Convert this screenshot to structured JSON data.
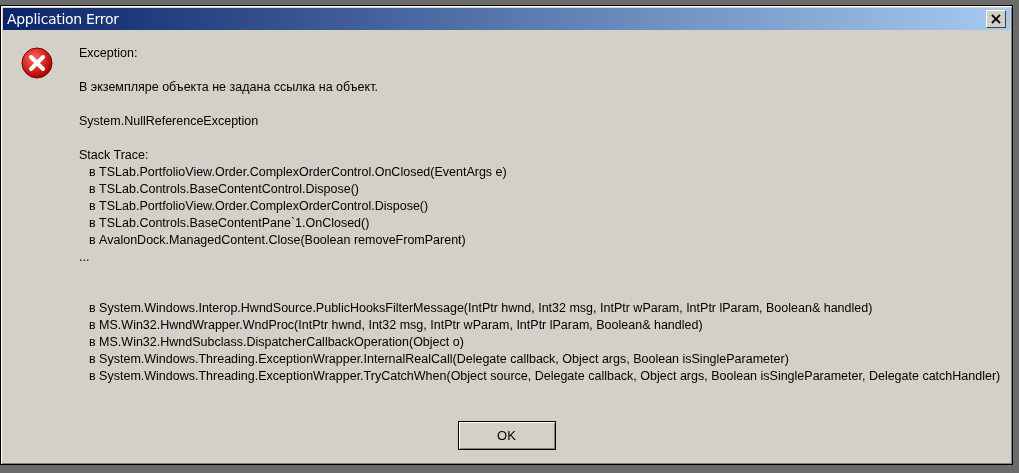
{
  "window": {
    "title": "Application Error",
    "close": "×"
  },
  "exception_label": "Exception:",
  "message": "В экземпляре объекта не задана ссылка на объект.",
  "exception_type": "System.NullReferenceException",
  "stack_trace_label": "Stack Trace:",
  "stack_trace": [
    "в TSLab.PortfolioView.Order.ComplexOrderControl.OnClosed(EventArgs e)",
    "в TSLab.Controls.BaseContentControl.Dispose()",
    "в TSLab.PortfolioView.Order.ComplexOrderControl.Dispose()",
    "в TSLab.Controls.BaseContentPane`1.OnClosed()",
    "в AvalonDock.ManagedContent.Close(Boolean removeFromParent)"
  ],
  "ellipsis": "...",
  "stack_trace_tail": [
    "в System.Windows.Interop.HwndSource.PublicHooksFilterMessage(IntPtr hwnd, Int32 msg, IntPtr wParam, IntPtr lParam, Boolean& handled)",
    "в MS.Win32.HwndWrapper.WndProc(IntPtr hwnd, Int32 msg, IntPtr wParam, IntPtr lParam, Boolean& handled)",
    "в MS.Win32.HwndSubclass.DispatcherCallbackOperation(Object o)",
    "в System.Windows.Threading.ExceptionWrapper.InternalRealCall(Delegate callback, Object args, Boolean isSingleParameter)",
    "в System.Windows.Threading.ExceptionWrapper.TryCatchWhen(Object source, Delegate callback, Object args, Boolean isSingleParameter, Delegate catchHandler)"
  ],
  "buttons": [
    "OK"
  ]
}
